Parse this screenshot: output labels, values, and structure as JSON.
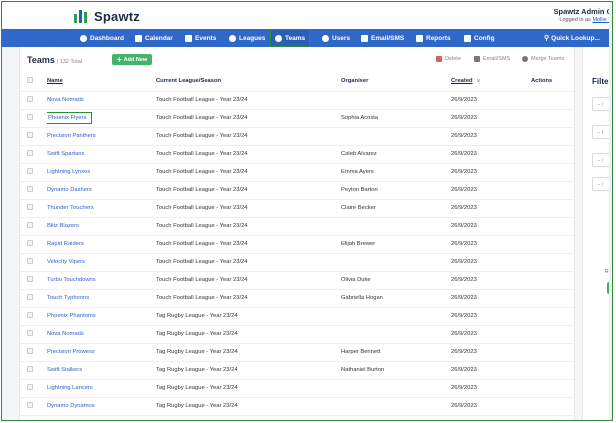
{
  "brand": {
    "name": "Spawtz"
  },
  "admin": {
    "name": "Spawtz Admin C",
    "logged_in_prefix": "Logged in as",
    "logged_in_user": "Mollie S"
  },
  "nav": {
    "items": [
      {
        "label": "Dashboard",
        "icon": "dashboard-icon"
      },
      {
        "label": "Calendar",
        "icon": "calendar-icon"
      },
      {
        "label": "Events",
        "icon": "events-icon"
      },
      {
        "label": "Leagues",
        "icon": "leagues-icon"
      },
      {
        "label": "Teams",
        "icon": "teams-icon"
      },
      {
        "label": "Users",
        "icon": "user-icon"
      },
      {
        "label": "Email/SMS",
        "icon": "email-icon"
      },
      {
        "label": "Reports",
        "icon": "reports-icon"
      },
      {
        "label": "Config",
        "icon": "wrench-icon"
      }
    ],
    "active": "Teams",
    "quick_lookup": "Quick Lookup..."
  },
  "page": {
    "title": "Teams",
    "total": "| 132 Total",
    "add_label": "Add New",
    "delete_label": "Delete",
    "email_label": "Email/SMS",
    "merge_label": "Merge Teams"
  },
  "table": {
    "headers": {
      "name": "Name",
      "league": "Current League/Season",
      "organiser": "Organiser",
      "created": "Created",
      "actions": "Actions"
    },
    "rows": [
      {
        "name": "Nova Nomads",
        "league": "Touch Football League - Year 23/24",
        "organiser": "",
        "created": "26/9/2023"
      },
      {
        "name": "Phoenix Flyers",
        "league": "Touch Football League - Year 23/24",
        "organiser": "Sophia Acosta",
        "created": "26/9/2023"
      },
      {
        "name": "Precision Panthers",
        "league": "Touch Football League - Year 23/24",
        "organiser": "",
        "created": "26/9/2023"
      },
      {
        "name": "Swift Spartans",
        "league": "Touch Football League - Year 23/24",
        "organiser": "Caleb Alvarez",
        "created": "26/9/2023"
      },
      {
        "name": "Lightning Lynxes",
        "league": "Touch Football League - Year 23/24",
        "organiser": "Emma Ayers",
        "created": "26/9/2023"
      },
      {
        "name": "Dynamo Dashers",
        "league": "Touch Football League - Year 23/24",
        "organiser": "Peyton Barton",
        "created": "26/9/2023"
      },
      {
        "name": "Thunder Touchers",
        "league": "Touch Football League - Year 23/24",
        "organiser": "Claire Becker",
        "created": "26/9/2023"
      },
      {
        "name": "Blitz Blazers",
        "league": "Touch Football League - Year 23/24",
        "organiser": "",
        "created": "26/9/2023"
      },
      {
        "name": "Rapid Raiders",
        "league": "Touch Football League - Year 23/24",
        "organiser": "Elijah Brewer",
        "created": "26/9/2023"
      },
      {
        "name": "Velocity Vipers",
        "league": "Touch Football League - Year 23/24",
        "organiser": "",
        "created": "26/9/2023"
      },
      {
        "name": "Turbo Touchdowns",
        "league": "Touch Football League - Year 23/24",
        "organiser": "Olivia Duke",
        "created": "26/9/2023"
      },
      {
        "name": "Touch Typhoons",
        "league": "Touch Football League - Year 23/24",
        "organiser": "Gabriella Hogan",
        "created": "26/9/2023"
      },
      {
        "name": "Phoenix Phantoms",
        "league": "Tag Rugby League - Year 23/24",
        "organiser": "",
        "created": "26/9/2023"
      },
      {
        "name": "Nova Nomads",
        "league": "Tag Rugby League - Year 23/24",
        "organiser": "",
        "created": "26/9/2023"
      },
      {
        "name": "Precision Prowess",
        "league": "Tag Rugby League - Year 23/24",
        "organiser": "Harper Bennett",
        "created": "26/9/2023"
      },
      {
        "name": "Swift Stalkers",
        "league": "Tag Rugby League - Year 23/24",
        "organiser": "Nathaniel Burton",
        "created": "26/9/2023"
      },
      {
        "name": "Lightning Lancers",
        "league": "Tag Rugby League - Year 23/24",
        "organiser": "",
        "created": "26/9/2023"
      },
      {
        "name": "Dynamo Dynamos",
        "league": "Tag Rugby League - Year 23/24",
        "organiser": "",
        "created": "26/9/2023"
      }
    ]
  },
  "filter": {
    "title": "Filter",
    "boxes": [
      "-- l",
      "-- l",
      "-- l",
      "-- l"
    ],
    "small_label": "R"
  },
  "colors": {
    "nav_bg": "#2f68c8",
    "accent_green": "#43b26b",
    "highlight_border": "#2e8b3a",
    "link": "#2f5fc8"
  }
}
